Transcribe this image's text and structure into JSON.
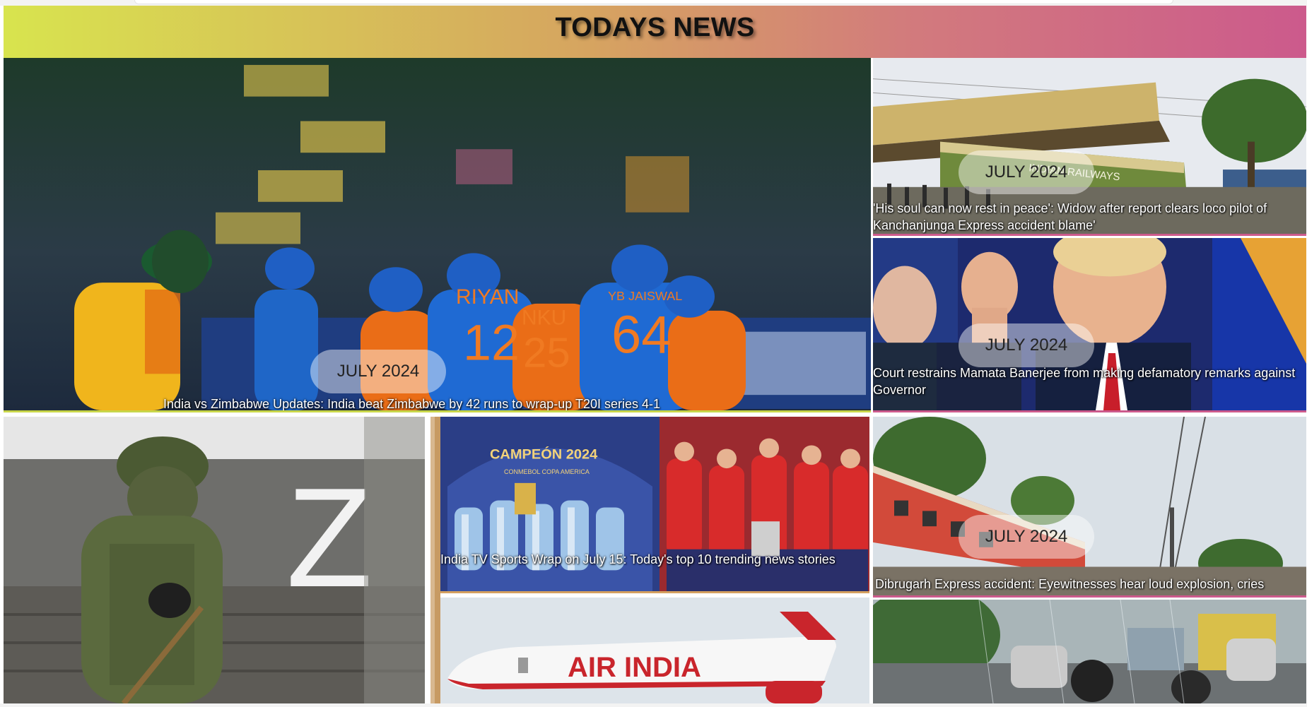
{
  "header": {
    "title": "TODAYS NEWS"
  },
  "cards": [
    {
      "date": "JULY 2024",
      "headline": "India vs Zimbabwe Updates: India beat Zimbabwe by 42 runs to wrap-up T20I series 4-1",
      "image": "cricket-team-celebration",
      "jerseys": [
        "RIYAN",
        "12",
        "NKU",
        "25",
        "YB JAISWAL",
        "64"
      ]
    },
    {
      "date": "JULY 2024",
      "headline": "'His soul can now rest in peace': Widow after report clears loco pilot of Kanchanjunga Express accident blame'",
      "image": "train-accident",
      "train_text": "INDIAN RAILWAYS"
    },
    {
      "date": "JULY 2024",
      "headline": "Court restrains Mamata Banerjee from making defamatory remarks against Governor",
      "image": "politician-raised-fist"
    },
    {
      "date": "",
      "headline": "",
      "image": "soldier-z-truck",
      "truck_mark": "Z"
    },
    {
      "date": "",
      "headline": "India TV Sports Wrap on July 15: Today's top 10 trending news stories",
      "image": "football-trophy-celebration",
      "banner_text": "CAMPEÓN 2024",
      "banner_sub": "CONMEBOL COPA AMERICA"
    },
    {
      "date": "JULY 2024",
      "headline": "Dibrugarh Express accident: Eyewitnesses hear loud explosion, cries",
      "image": "derailed-train-coaches"
    },
    {
      "date": "",
      "headline": "",
      "image": "air-india-plane",
      "plane_text": "AIR INDIA"
    },
    {
      "date": "",
      "headline": "",
      "image": "rainy-street-traffic"
    }
  ]
}
